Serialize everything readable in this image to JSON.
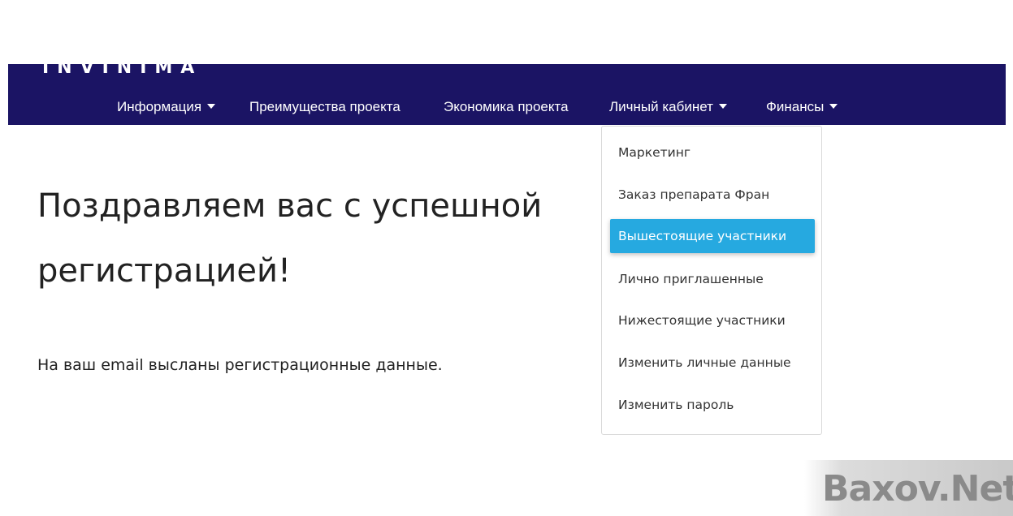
{
  "header": {
    "logo_text": "INVINIMA",
    "nav": [
      {
        "label": "Информация",
        "has_dropdown": true
      },
      {
        "label": "Преимущества проекта",
        "has_dropdown": false
      },
      {
        "label": "Экономика проекта",
        "has_dropdown": false
      },
      {
        "label": "Личный кабинет",
        "has_dropdown": true
      },
      {
        "label": "Финансы",
        "has_dropdown": true
      }
    ]
  },
  "main": {
    "heading_line1": "Поздравляем вас с успешной",
    "heading_line2": "регистрацией!",
    "subtext": "На ваш email высланы регистрационные данные."
  },
  "dropdown": {
    "open_menu": "Личный кабинет",
    "items": [
      {
        "label": "Маркетинг",
        "active": false
      },
      {
        "label": "Заказ препарата Фран",
        "active": false
      },
      {
        "label": "Вышестоящие участники",
        "active": true
      },
      {
        "label": "Лично приглашенные",
        "active": false
      },
      {
        "label": "Нижестоящие участники",
        "active": false
      },
      {
        "label": "Изменить личные данные",
        "active": false
      },
      {
        "label": "Изменить пароль",
        "active": false
      }
    ]
  },
  "watermark": {
    "text": "Baxov.Net"
  },
  "colors": {
    "navbar_bg": "#1b1464",
    "active_item_bg": "#26a9e0",
    "text": "#222222"
  }
}
